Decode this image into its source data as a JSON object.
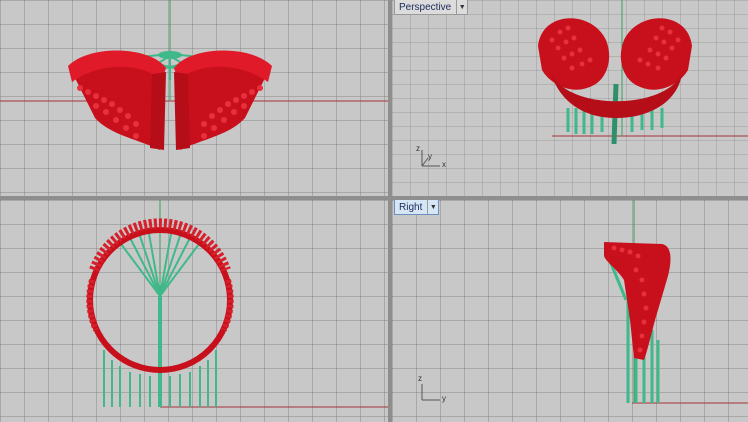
{
  "viewports": {
    "top_left": {
      "name": "",
      "gizmo": []
    },
    "top_right": {
      "name": "Perspective",
      "gizmo": [
        "z",
        "y",
        "x"
      ]
    },
    "bottom_left": {
      "name": "",
      "gizmo": []
    },
    "bottom_right": {
      "name": "Right",
      "gizmo": [
        "z",
        "y"
      ]
    }
  },
  "icons": {
    "menu": "dropdown-arrow-icon"
  },
  "colors": {
    "background": "#c8c8c8",
    "model_red": "#d11020",
    "support_green": "#3fb98a",
    "x_axis": "#a8323a",
    "y_axis": "#3aa05a"
  }
}
